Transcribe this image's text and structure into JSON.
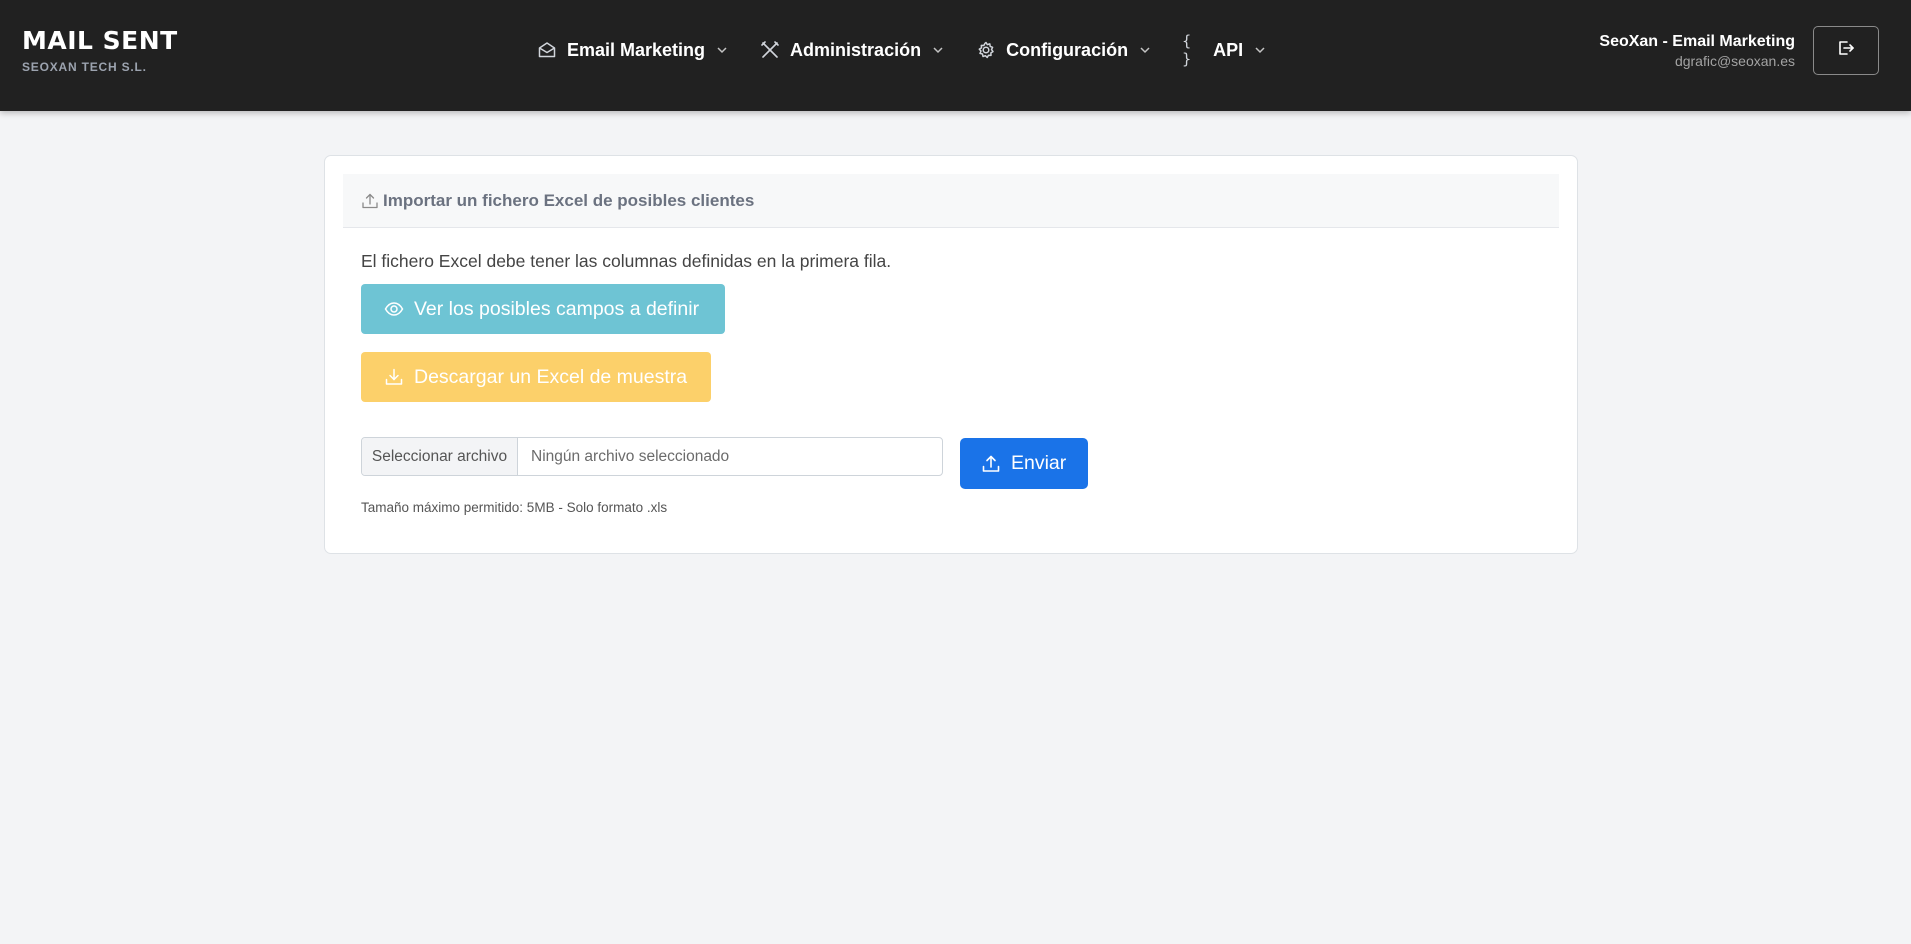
{
  "brand": {
    "title": "MAIL SENT",
    "subtitle": "SEOXAN TECH S.L."
  },
  "nav": {
    "items": [
      {
        "label": "Email Marketing",
        "icon": "envelope-open-icon"
      },
      {
        "label": "Administración",
        "icon": "tools-icon"
      },
      {
        "label": "Configuración",
        "icon": "gear-icon"
      },
      {
        "label": "API",
        "icon": "braces-icon"
      }
    ]
  },
  "user": {
    "name": "SeoXan - Email Marketing",
    "email": "dgrafic@seoxan.es",
    "logout_icon": "logout-icon"
  },
  "card": {
    "header": "Importar un fichero Excel de posibles clientes",
    "description": "El fichero Excel debe tener las columnas definidas en la primera fila.",
    "view_fields_button": "Ver los posibles campos a definir",
    "download_sample_button": "Descargar un Excel de muestra",
    "file_input": {
      "button_label": "Seleccionar archivo",
      "status": "Ningún archivo seleccionado"
    },
    "submit_button": "Enviar",
    "hint": "Tamaño máximo permitido: 5MB - Solo formato .xls"
  },
  "colors": {
    "navbar": "#212121",
    "background": "#f3f4f6",
    "info": "#6ec4d4",
    "warning": "#fcd06a",
    "primary": "#1a73e8"
  }
}
